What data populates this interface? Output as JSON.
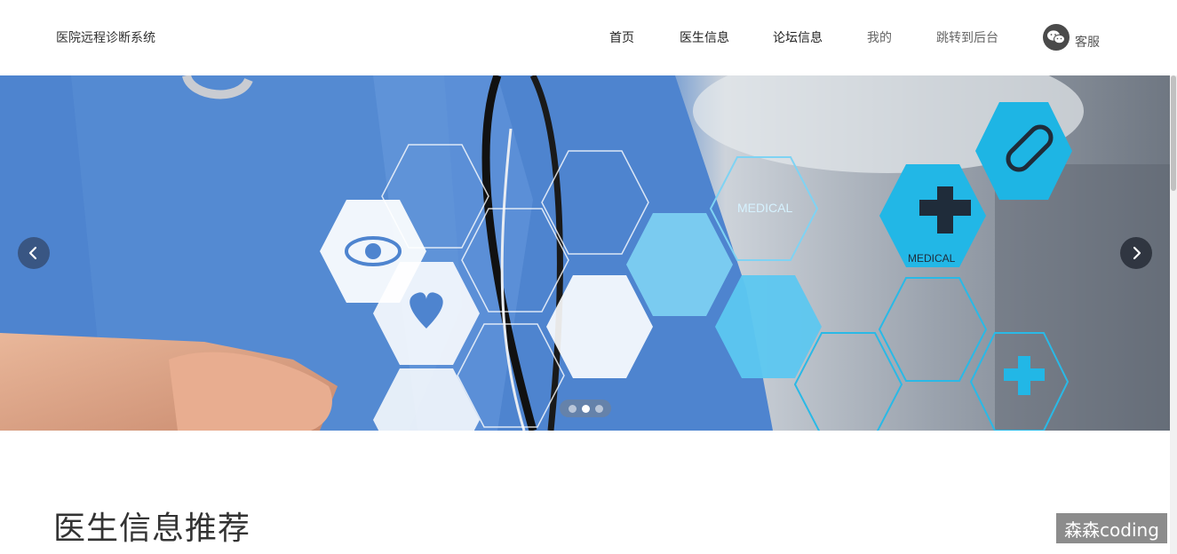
{
  "header": {
    "site_title": "医院远程诊断系统",
    "nav": {
      "home": "首页",
      "doctor_info": "医生信息",
      "forum_info": "论坛信息",
      "mine": "我的",
      "to_admin": "跳转到后台"
    },
    "customer_service": "客服"
  },
  "banner": {
    "slide_count": 3,
    "active_slide": 2,
    "hex_labels": [
      "MEDICAL",
      "MEDICAL"
    ],
    "icon_names": [
      "chevron-left-icon",
      "chevron-right-icon",
      "wechat-icon"
    ]
  },
  "main": {
    "section_title": "医生信息推荐"
  },
  "watermark": "森森coding"
}
